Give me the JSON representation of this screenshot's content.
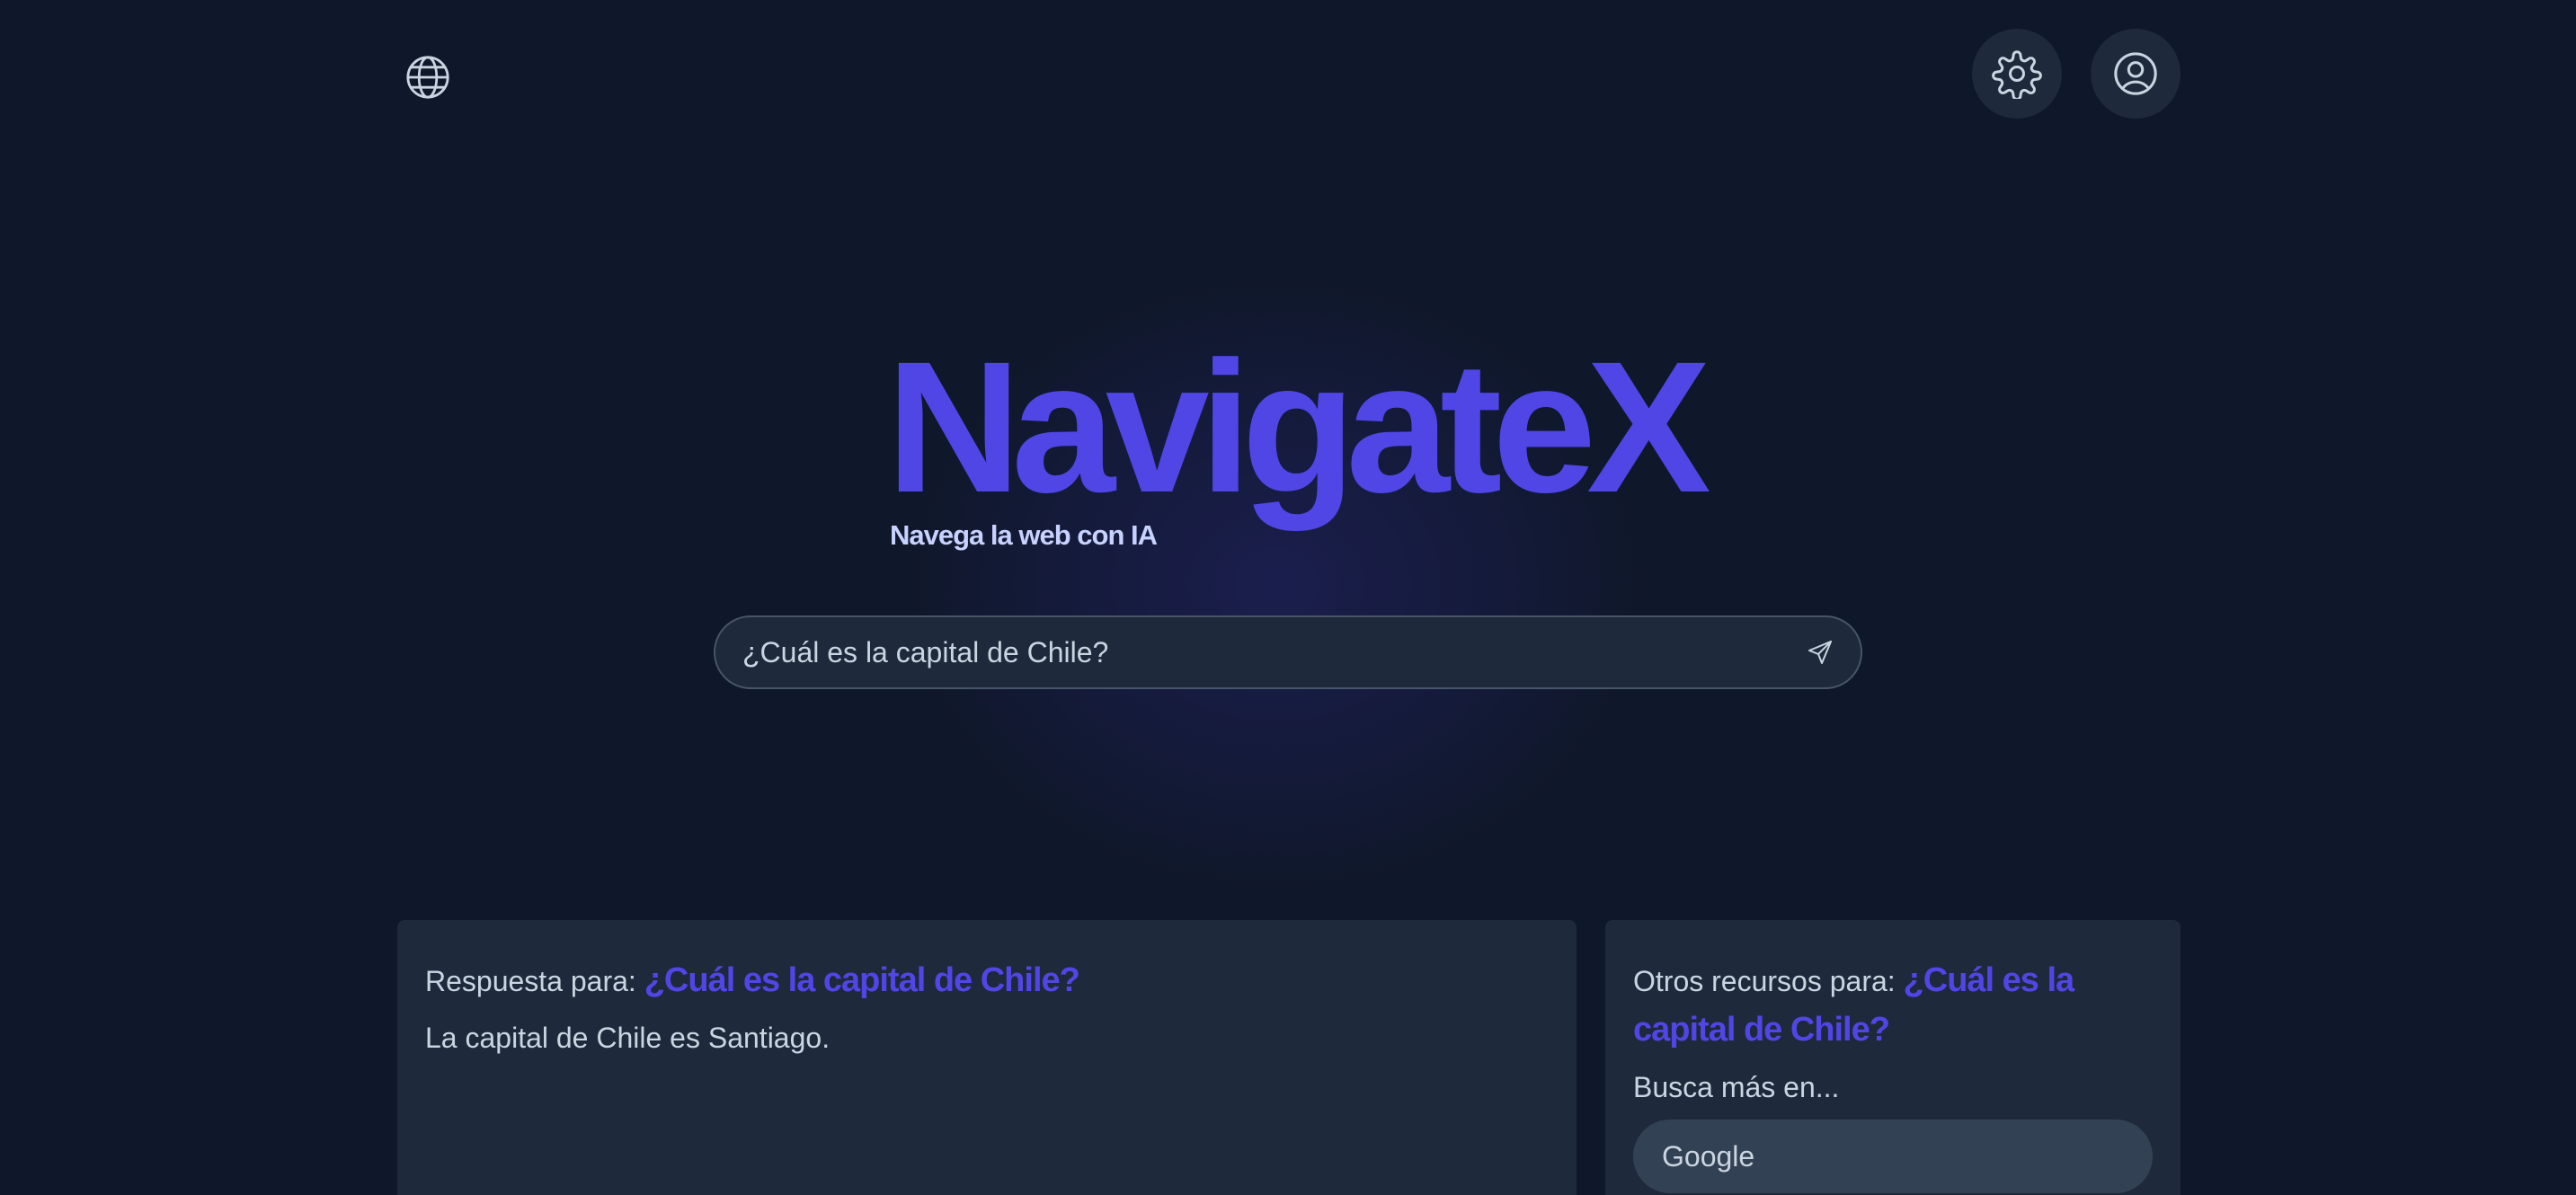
{
  "header": {
    "language_icon": "globe-icon",
    "settings_icon": "gear-icon",
    "profile_icon": "user-circle-icon"
  },
  "hero": {
    "logo": "NavigateX",
    "tagline": "Navega la web con IA"
  },
  "search": {
    "value": "¿Cuál es la capital de Chile?",
    "send_icon": "send-icon"
  },
  "answer": {
    "label": "Respuesta para: ",
    "query": "¿Cuál es la capital de Chile?",
    "text": "La capital de Chile es Santiago."
  },
  "resources": {
    "label": "Otros recursos para: ",
    "query": "¿Cuál es la capital de Chile?",
    "more_label": "Busca más en...",
    "engines": [
      "Google"
    ]
  },
  "colors": {
    "background": "#0f172a",
    "surface": "#1e293b",
    "accent": "#4f46e5",
    "text": "#cbd5e1"
  }
}
